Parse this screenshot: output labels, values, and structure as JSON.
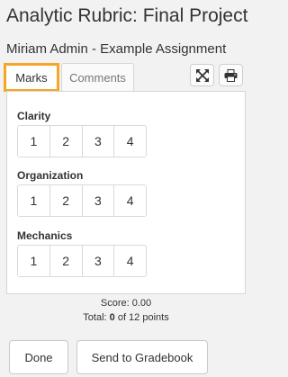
{
  "header": {
    "title": "Analytic Rubric: Final Project",
    "subtitle": "Miriam Admin - Example Assignment"
  },
  "tabs": [
    {
      "label": "Marks",
      "active": true
    },
    {
      "label": "Comments",
      "active": false
    }
  ],
  "toolbar": {
    "expand_icon": "expand-arrows-icon",
    "print_icon": "printer-icon"
  },
  "criteria": [
    {
      "name": "Clarity",
      "levels": [
        "1",
        "2",
        "3",
        "4"
      ]
    },
    {
      "name": "Organization",
      "levels": [
        "1",
        "2",
        "3",
        "4"
      ]
    },
    {
      "name": "Mechanics",
      "levels": [
        "1",
        "2",
        "3",
        "4"
      ]
    }
  ],
  "summary": {
    "score_label": "Score: 0.00",
    "total_prefix": "Total: ",
    "total_value": "0",
    "total_suffix": " of 12 points"
  },
  "actions": {
    "done_label": "Done",
    "send_label": "Send to Gradebook"
  },
  "colors": {
    "active_tab_outline": "#f5a623",
    "background": "#f2f2f2"
  }
}
